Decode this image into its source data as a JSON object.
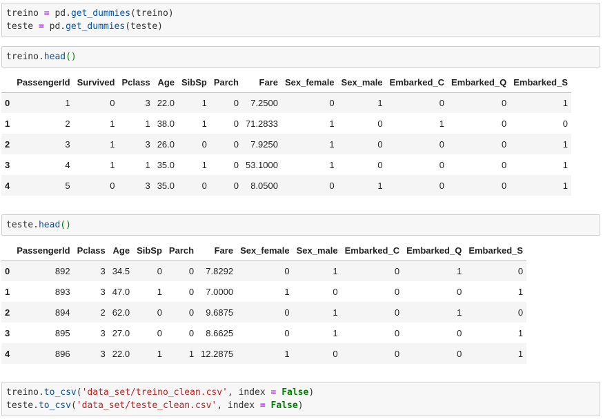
{
  "cells": {
    "cell1": {
      "line1": {
        "var": "treino",
        "op": "=",
        "mod": "pd.",
        "fn": "get_dummies",
        "open": "(",
        "arg": "treino",
        "close": ")"
      },
      "line2": {
        "var": "teste",
        "op": "=",
        "mod": "pd.",
        "fn": "get_dummies",
        "open": "(",
        "arg": "teste",
        "close": ")"
      }
    },
    "cell2": {
      "obj": "treino.",
      "fn": "head",
      "parens": "()"
    },
    "cell3": {
      "obj": "teste.",
      "fn": "head",
      "parens": "()"
    },
    "cell4": {
      "line1": {
        "obj": "treino.",
        "fn": "to_csv",
        "open": "(",
        "str": "'data_set/treino_clean.csv'",
        "sep": ", index ",
        "op": "=",
        "kw": "False",
        "close": ")"
      },
      "line2": {
        "obj": "teste.",
        "fn": "to_csv",
        "open": "(",
        "str": "'data_set/teste_clean.csv'",
        "sep": ", index ",
        "op": "=",
        "kw": "False",
        "close": ")"
      }
    }
  },
  "treino_table": {
    "columns": [
      "",
      "PassengerId",
      "Survived",
      "Pclass",
      "Age",
      "SibSp",
      "Parch",
      "Fare",
      "Sex_female",
      "Sex_male",
      "Embarked_C",
      "Embarked_Q",
      "Embarked_S"
    ],
    "rows": [
      [
        "0",
        "1",
        "0",
        "3",
        "22.0",
        "1",
        "0",
        "7.2500",
        "0",
        "1",
        "0",
        "0",
        "1"
      ],
      [
        "1",
        "2",
        "1",
        "1",
        "38.0",
        "1",
        "0",
        "71.2833",
        "1",
        "0",
        "1",
        "0",
        "0"
      ],
      [
        "2",
        "3",
        "1",
        "3",
        "26.0",
        "0",
        "0",
        "7.9250",
        "1",
        "0",
        "0",
        "0",
        "1"
      ],
      [
        "3",
        "4",
        "1",
        "1",
        "35.0",
        "1",
        "0",
        "53.1000",
        "1",
        "0",
        "0",
        "0",
        "1"
      ],
      [
        "4",
        "5",
        "0",
        "3",
        "35.0",
        "0",
        "0",
        "8.0500",
        "0",
        "1",
        "0",
        "0",
        "1"
      ]
    ]
  },
  "teste_table": {
    "columns": [
      "",
      "PassengerId",
      "Pclass",
      "Age",
      "SibSp",
      "Parch",
      "Fare",
      "Sex_female",
      "Sex_male",
      "Embarked_C",
      "Embarked_Q",
      "Embarked_S"
    ],
    "rows": [
      [
        "0",
        "892",
        "3",
        "34.5",
        "0",
        "0",
        "7.8292",
        "0",
        "1",
        "0",
        "1",
        "0"
      ],
      [
        "1",
        "893",
        "3",
        "47.0",
        "1",
        "0",
        "7.0000",
        "1",
        "0",
        "0",
        "0",
        "1"
      ],
      [
        "2",
        "894",
        "2",
        "62.0",
        "0",
        "0",
        "9.6875",
        "0",
        "1",
        "0",
        "1",
        "0"
      ],
      [
        "3",
        "895",
        "3",
        "27.0",
        "0",
        "0",
        "8.6625",
        "0",
        "1",
        "0",
        "0",
        "1"
      ],
      [
        "4",
        "896",
        "3",
        "22.0",
        "1",
        "1",
        "12.2875",
        "1",
        "0",
        "0",
        "0",
        "1"
      ]
    ]
  },
  "colors": {
    "cell_background": "#f7f7f7",
    "operator": "#aa22ff",
    "function": "#0055aa",
    "string": "#ba2121",
    "keyword": "#008000",
    "stripe": "#f5f5f5"
  }
}
